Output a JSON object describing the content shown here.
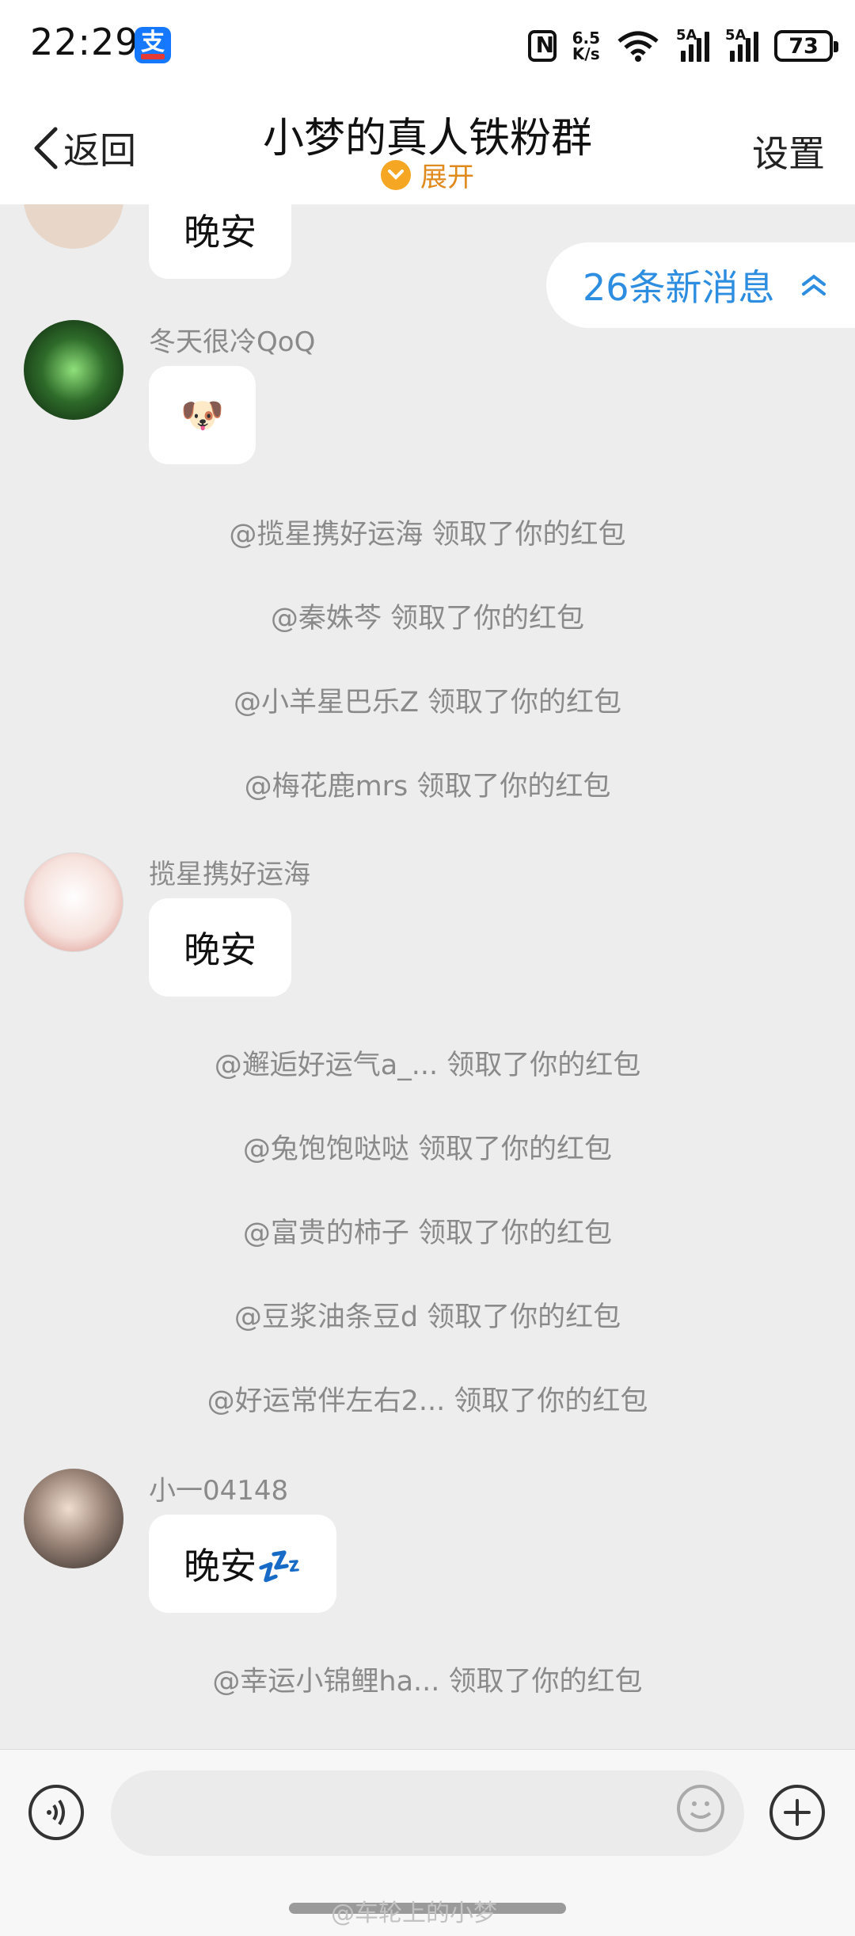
{
  "status_bar": {
    "time": "22:29",
    "app_icon_char": "支",
    "net_speed_top": "6.5",
    "net_speed_bottom": "K/s",
    "signal_label_1": "5A",
    "signal_label_2": "5A",
    "battery": "73"
  },
  "header": {
    "back_label": "返回",
    "title": "小梦的真人铁粉群",
    "expand_label": "展开",
    "settings_label": "设置"
  },
  "new_messages_label": "26条新消息",
  "messages": {
    "top_bubble": "晚安",
    "m1_sender": "冬天很冷QoQ",
    "m1_emoji": "🐶",
    "sys1": "@揽星携好运海 领取了你的红包",
    "sys2": "@秦姝芩 领取了你的红包",
    "sys3": "@小羊星巴乐Z 领取了你的红包",
    "sys4": "@梅花鹿mrs 领取了你的红包",
    "m2_sender": "揽星携好运海",
    "m2_text": "晚安",
    "sys5": "@邂逅好运气a_... 领取了你的红包",
    "sys6": "@兔饱饱哒哒 领取了你的红包",
    "sys7": "@富贵的柿子 领取了你的红包",
    "sys8": "@豆浆油条豆d 领取了你的红包",
    "sys9": "@好运常伴左右2... 领取了你的红包",
    "m3_sender": "小一04148",
    "m3_text": "晚安💤",
    "sys10": "@幸运小锦鲤ha... 领取了你的红包"
  },
  "watermark": "@车轮上的小梦",
  "colors": {
    "accent_blue": "#2d8de0",
    "expand_orange": "#f5a623",
    "chat_bg": "#ededed"
  }
}
